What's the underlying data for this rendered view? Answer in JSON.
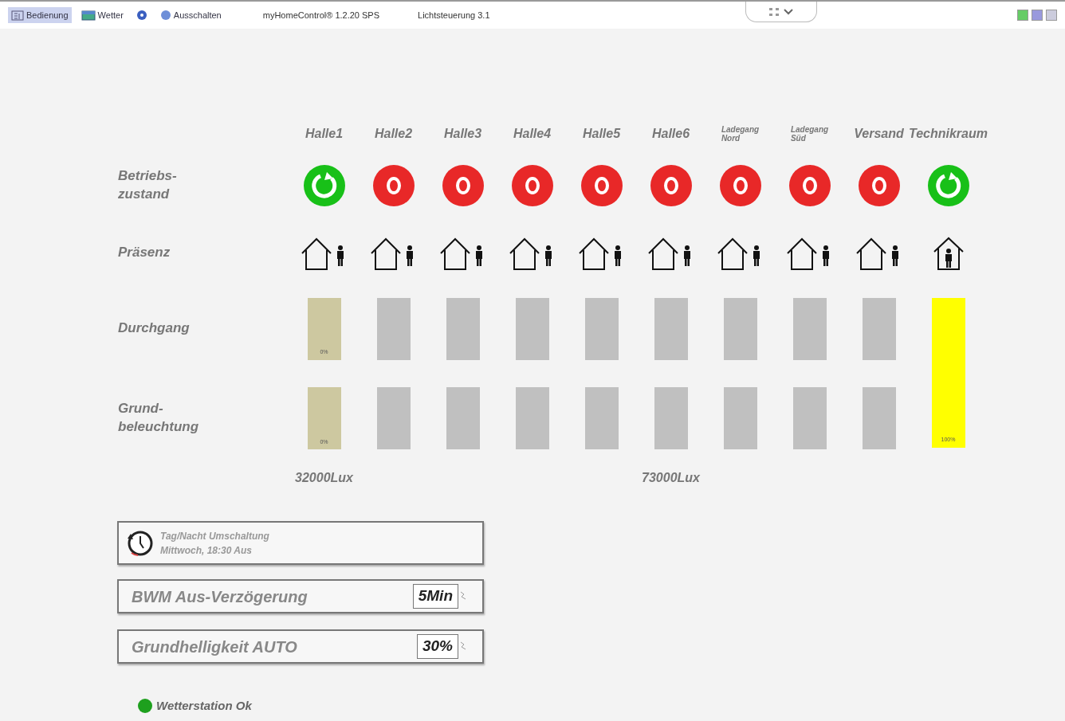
{
  "toolbar": {
    "items": [
      {
        "kind": "menu",
        "label": "Bedienung",
        "selected": true
      },
      {
        "kind": "menu",
        "label": "Wetter",
        "selected": false
      },
      {
        "kind": "info",
        "selected": false
      },
      {
        "kind": "power",
        "label": "Ausschalten",
        "selected": false
      }
    ],
    "app_title": "myHomeControl® 1.2.20 SPS",
    "project_title": "Lichtsteuerung 3.1"
  },
  "row_labels": [
    "Betriebs-\nzustand",
    "Präsenz",
    "Durchgang",
    "Grund-\nbeleuchtung"
  ],
  "columns": [
    {
      "name": "Halle1",
      "small": false,
      "running": true,
      "occupied": false,
      "bars": [
        {
          "color": "#cdc8a0",
          "label": "0%"
        },
        {
          "color": "#cdc8a0",
          "label": "0%"
        }
      ],
      "lux": "32000Lux"
    },
    {
      "name": "Halle2",
      "small": false,
      "running": false,
      "occupied": false,
      "bars": [
        {
          "color": "#c0c0c0"
        },
        {
          "color": "#c0c0c0"
        }
      ]
    },
    {
      "name": "Halle3",
      "small": false,
      "running": false,
      "occupied": false,
      "bars": [
        {
          "color": "#c0c0c0"
        },
        {
          "color": "#c0c0c0"
        }
      ]
    },
    {
      "name": "Halle4",
      "small": false,
      "running": false,
      "occupied": false,
      "bars": [
        {
          "color": "#c0c0c0"
        },
        {
          "color": "#c0c0c0"
        }
      ]
    },
    {
      "name": "Halle5",
      "small": false,
      "running": false,
      "occupied": false,
      "bars": [
        {
          "color": "#c0c0c0"
        },
        {
          "color": "#c0c0c0"
        }
      ]
    },
    {
      "name": "Halle6",
      "small": false,
      "running": false,
      "occupied": false,
      "bars": [
        {
          "color": "#c0c0c0"
        },
        {
          "color": "#c0c0c0"
        }
      ],
      "lux": "73000Lux"
    },
    {
      "name": "Ladegang\nNord",
      "small": true,
      "running": false,
      "occupied": false,
      "bars": [
        {
          "color": "#c0c0c0"
        },
        {
          "color": "#c0c0c0"
        }
      ]
    },
    {
      "name": "Ladegang\nSüd",
      "small": true,
      "running": false,
      "occupied": false,
      "bars": [
        {
          "color": "#c0c0c0"
        },
        {
          "color": "#c0c0c0"
        }
      ]
    },
    {
      "name": "Versand",
      "small": false,
      "running": false,
      "occupied": false,
      "bars": [
        {
          "color": "#c0c0c0"
        },
        {
          "color": "#c0c0c0"
        }
      ]
    },
    {
      "name": "Technikraum",
      "small": false,
      "running": true,
      "occupied": true,
      "bars": [
        {
          "color": "#ffff00",
          "label": "100%"
        }
      ]
    }
  ],
  "schedule": {
    "title": "Tag/Nacht Umschaltung",
    "detail": "Mittwoch, 18:30 Aus"
  },
  "settings": [
    {
      "label": "BWM Aus-Verzögerung",
      "value": "5Min"
    },
    {
      "label": "Grundhelligkeit AUTO",
      "value": "30%"
    }
  ],
  "status": {
    "text": "Wetterstation Ok",
    "ok": true
  }
}
